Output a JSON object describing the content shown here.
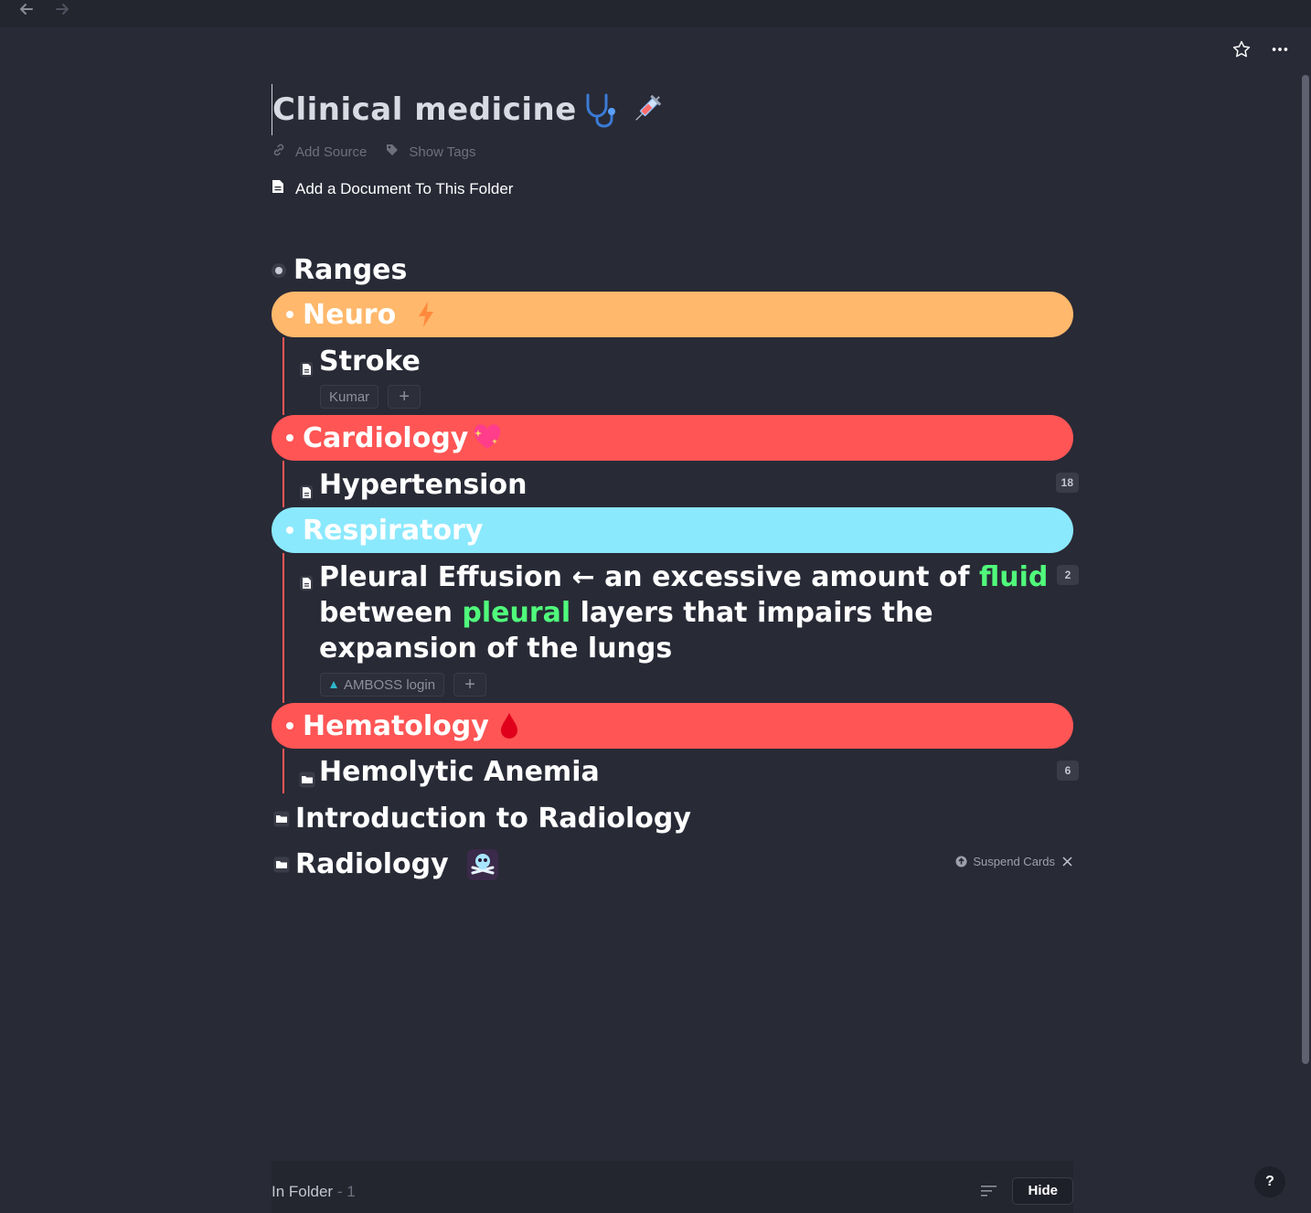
{
  "nav": {
    "back_icon": "arrow-left-icon",
    "forward_icon": "arrow-right-icon"
  },
  "page_actions": {
    "star_icon": "star-icon",
    "more_icon": "more-horizontal-icon"
  },
  "title": {
    "text": "Clinical medicine",
    "icons": [
      "stethoscope-icon",
      "syringe-icon"
    ]
  },
  "meta": {
    "add_source": "Add Source",
    "show_tags": "Show Tags"
  },
  "add_document": "Add a Document To This Folder",
  "outline": {
    "ranges_label": "Ranges",
    "sections": [
      {
        "label": "Neuro",
        "color": "#ffb86c",
        "icon": "lightning-icon",
        "children": [
          {
            "label": "Stroke",
            "tags": [
              "Kumar"
            ]
          }
        ]
      },
      {
        "label": "Cardiology",
        "color": "#ff5555",
        "icon": "sparkling-heart-icon",
        "children": [
          {
            "label": "Hypertension",
            "badge": "18"
          }
        ]
      },
      {
        "label": "Respiratory",
        "color": "#8be9fd",
        "children": [
          {
            "label": "Pleural Effusion",
            "arrow": "←",
            "def_1": "an excessive amount of",
            "def_hl_1": "fluid",
            "def_2": "between",
            "def_hl_2": "pleural",
            "def_3": "layers that impairs the expansion of the lungs",
            "badge": "2",
            "tags": [
              "AMBOSS login"
            ]
          }
        ]
      },
      {
        "label": "Hematology",
        "color": "#ff5555",
        "icon": "blood-drop-icon",
        "children": [
          {
            "label": "Hemolytic Anemia",
            "badge": "6"
          }
        ]
      }
    ],
    "root_items": [
      {
        "label": "Introduction to Radiology"
      },
      {
        "label": "Radiology",
        "icon": "skull-crossbones-icon"
      }
    ],
    "suspend_cards": "Suspend Cards"
  },
  "bottom_bar": {
    "label": "In Folder",
    "separator": "-",
    "count": "1",
    "hide": "Hide"
  },
  "help": "?",
  "colors": {
    "background": "#282a36",
    "green": "#50fa7b",
    "red": "#ff5555",
    "orange": "#ffb86c",
    "cyan": "#8be9fd"
  }
}
